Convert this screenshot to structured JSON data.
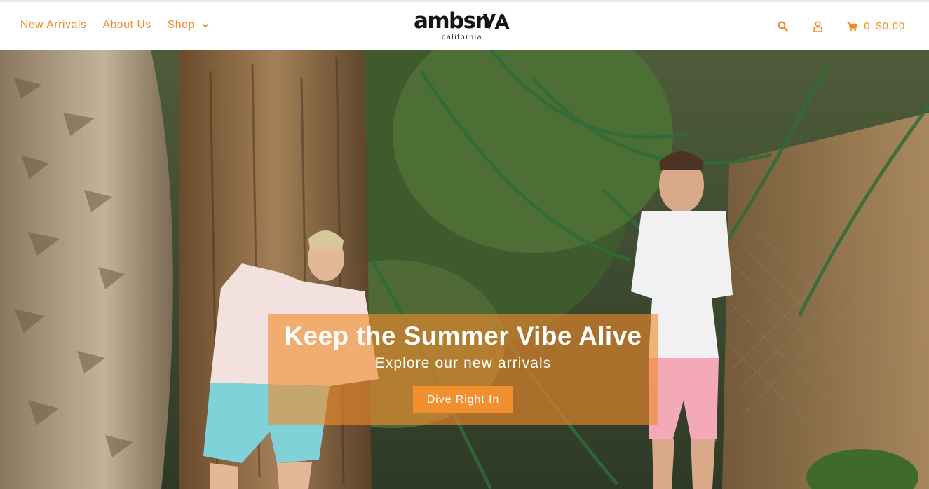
{
  "header": {
    "nav": [
      {
        "label": "New Arrivals"
      },
      {
        "label": "About Us"
      },
      {
        "label": "Shop",
        "has_dropdown": true
      }
    ],
    "logo": {
      "wordmark": "ambsn",
      "subtitle": "california"
    },
    "icons": {
      "search": "search-icon",
      "account": "user-icon",
      "cart": "cart-icon",
      "dropdown": "chevron-down-icon"
    },
    "cart": {
      "count": "0",
      "total": "$0.00"
    }
  },
  "hero": {
    "title": "Keep the Summer Vibe Alive",
    "subtitle": "Explore our new arrivals",
    "cta_label": "Dive Right In"
  },
  "theme": {
    "accent": "#f08b2b",
    "overlay": "rgba(240,139,43,0.62)",
    "text_dark": "#151515"
  }
}
